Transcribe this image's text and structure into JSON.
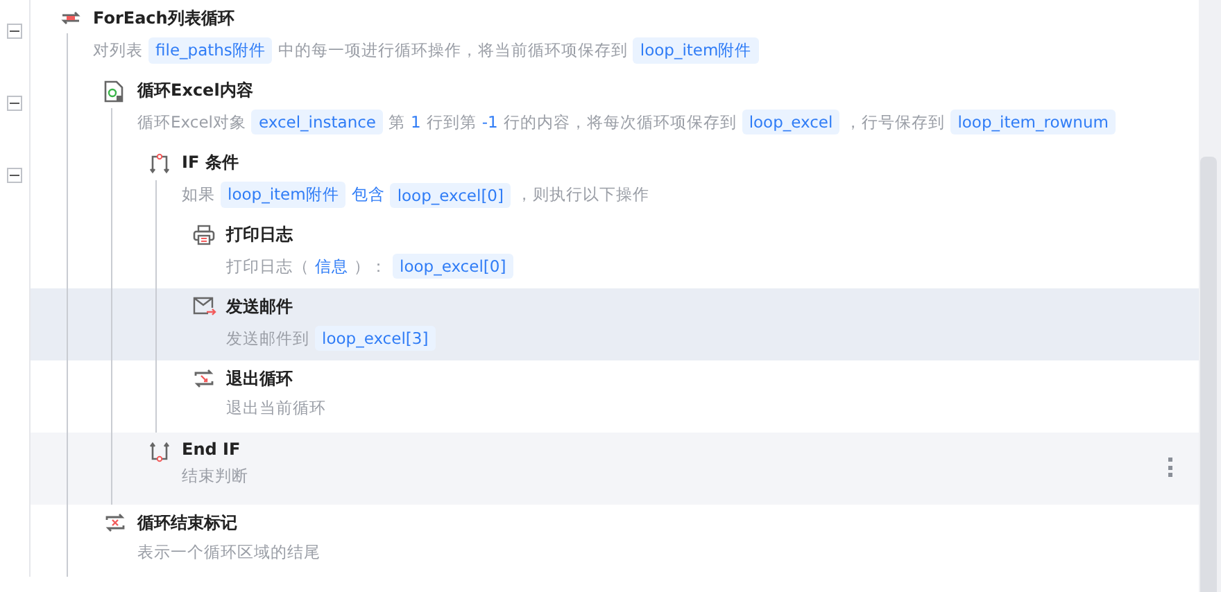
{
  "steps": [
    {
      "title": "ForEach列表循环",
      "kind": "loop",
      "expanded": true,
      "selected": false,
      "hovered": false,
      "description": [
        {
          "kind": "text",
          "text": "对列表"
        },
        {
          "kind": "chip",
          "text": "file_paths附件"
        },
        {
          "kind": "text",
          "text": "中的每一项进行循环操作，将当前循环项保存到"
        },
        {
          "kind": "chip",
          "text": "loop_item附件"
        }
      ],
      "children": [
        {
          "title": "循环Excel内容",
          "kind": "excel",
          "expanded": true,
          "selected": false,
          "hovered": false,
          "description": [
            {
              "kind": "text",
              "text": "循环Excel对象"
            },
            {
              "kind": "chip",
              "text": "excel_instance"
            },
            {
              "kind": "text",
              "text": "第"
            },
            {
              "kind": "value",
              "text": "1"
            },
            {
              "kind": "text",
              "text": "行到第"
            },
            {
              "kind": "value",
              "text": "-1"
            },
            {
              "kind": "text",
              "text": "行的内容，将每次循环项保存到"
            },
            {
              "kind": "chip",
              "text": "loop_excel"
            },
            {
              "kind": "text",
              "text": "，行号保存到"
            },
            {
              "kind": "chip",
              "text": "loop_item_rownum"
            }
          ],
          "children": [
            {
              "title": "IF 条件",
              "kind": "if",
              "expanded": true,
              "selected": false,
              "hovered": false,
              "description": [
                {
                  "kind": "text",
                  "text": "如果"
                },
                {
                  "kind": "chip",
                  "text": "loop_item附件"
                },
                {
                  "kind": "value",
                  "text": "包含"
                },
                {
                  "kind": "chip",
                  "text": "loop_excel[0]"
                },
                {
                  "kind": "text",
                  "text": "，则执行以下操作"
                }
              ],
              "children": [
                {
                  "title": "打印日志",
                  "kind": "print",
                  "selected": false,
                  "hovered": false,
                  "description": [
                    {
                      "kind": "text",
                      "text": "打印日志（"
                    },
                    {
                      "kind": "value",
                      "text": "信息"
                    },
                    {
                      "kind": "text",
                      "text": "）："
                    },
                    {
                      "kind": "chip",
                      "text": "loop_excel[0]"
                    }
                  ]
                },
                {
                  "title": "发送邮件",
                  "kind": "mail",
                  "selected": true,
                  "hovered": false,
                  "description": [
                    {
                      "kind": "text",
                      "text": "发送邮件到"
                    },
                    {
                      "kind": "chip",
                      "text": "loop_excel[3]"
                    }
                  ]
                },
                {
                  "title": "退出循环",
                  "kind": "break",
                  "selected": false,
                  "hovered": false,
                  "description": [
                    {
                      "kind": "text",
                      "text": "退出当前循环"
                    }
                  ]
                }
              ]
            },
            {
              "title": "End IF",
              "kind": "endif",
              "selected": false,
              "hovered": true,
              "description": [
                {
                  "kind": "text",
                  "text": "结束判断"
                }
              ]
            }
          ]
        },
        {
          "title": "循环结束标记",
          "kind": "loopend",
          "selected": false,
          "hovered": false,
          "description": [
            {
              "kind": "text",
              "text": "表示一个循环区域的结尾"
            }
          ]
        }
      ]
    }
  ]
}
